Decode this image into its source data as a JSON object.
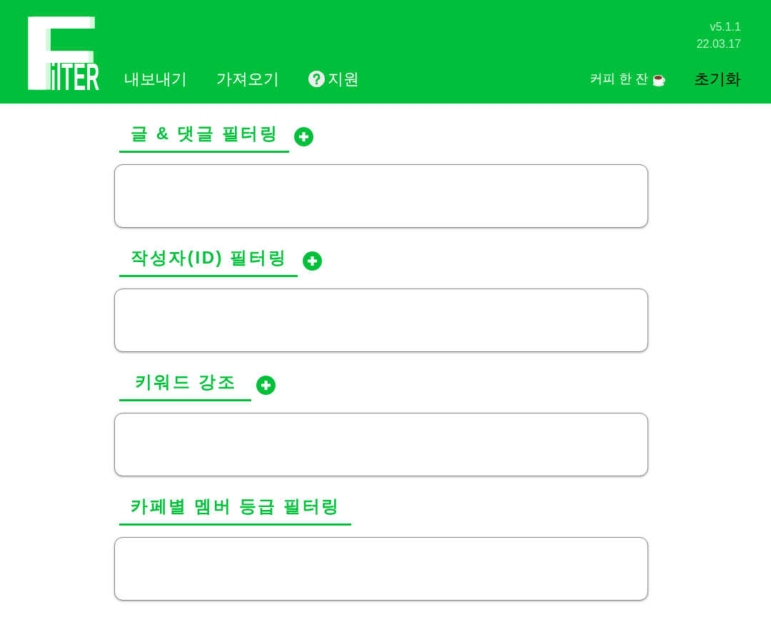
{
  "header": {
    "logo": "FilTER",
    "nav": [
      {
        "label": "내보내기",
        "kind": "link"
      },
      {
        "label": "가져오기",
        "kind": "link"
      },
      {
        "label": "지원",
        "kind": "help"
      }
    ],
    "version": "v5.1.1",
    "date": "22.03.17",
    "coffee": "커피 한 잔",
    "reset": "초기화"
  },
  "sections": [
    {
      "title": "글 & 댓글 필터링",
      "add_button": true
    },
    {
      "title": "작성자(ID) 필터링",
      "add_button": true
    },
    {
      "title": "키워드 강조",
      "add_button": true
    },
    {
      "title": "카페별 멤버 등급 필터링",
      "add_button": false
    }
  ]
}
